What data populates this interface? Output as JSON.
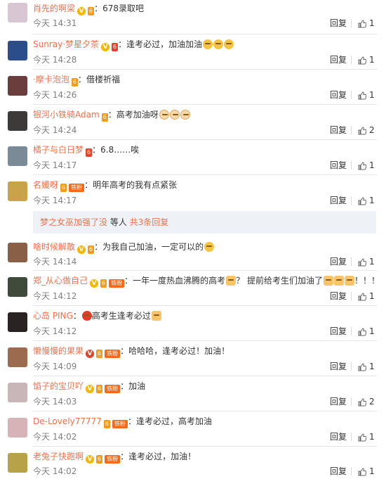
{
  "ui": {
    "reply_label": "回复"
  },
  "comments": [
    {
      "username": "肖先的啊梁",
      "text": "678录取吧",
      "time": "今天 14:31",
      "likes": "1",
      "avatar_color": "#d8c6d3"
    },
    {
      "username": "Sunray·梦星夕茶",
      "text": "逢考必过，加油加油",
      "time": "今天 14:28",
      "likes": "1",
      "avatar_color": "#2b4d8a"
    },
    {
      "username": "·摩卡泡泡",
      "text": "借楼祈福",
      "time": "今天 14:26",
      "likes": "1",
      "avatar_color": "#6b3d3d"
    },
    {
      "username": "银河小铁骑Adam",
      "text": "高考加油呀",
      "time": "今天 14:24",
      "likes": "2",
      "avatar_color": "#3d3a3a"
    },
    {
      "username": "橘子与白日梦",
      "text": "6.8……唉",
      "time": "今天 14:17",
      "likes": "1",
      "avatar_color": "#7a8a96"
    },
    {
      "username": "名媛呀",
      "text": "明年高考的我有点紧张",
      "time": "今天 14:17",
      "likes": "1",
      "avatar_color": "#c9a24a"
    },
    {
      "username": "啥时候解散",
      "text": "为我自己加油，一定可以的",
      "time": "今天 14:14",
      "likes": "1",
      "avatar_color": "#8a5f48"
    },
    {
      "username": "郑_从心做自己",
      "text": "一年一度热血沸腾的高考",
      "text2": "？ 提前给考生们加油了",
      "text3": "！！！",
      "time": "今天 14:12",
      "likes": "1",
      "avatar_color": "#3f4a3a"
    },
    {
      "username": "心岛 PING",
      "text": "高考生逢考必过",
      "time": "今天 14:12",
      "likes": "1",
      "avatar_color": "#2a2323"
    },
    {
      "username": "懒慢慢的果果",
      "text": "哈哈哈，逢考必过！加油！",
      "time": "今天 14:09",
      "likes": "1",
      "avatar_color": "#9b6a4f"
    },
    {
      "username": "馅子的宝贝吖",
      "text": "加油",
      "time": "今天 14:03",
      "likes": "2",
      "avatar_color": "#c9b6b8"
    },
    {
      "username": "De-Lovely77777",
      "text": "逢考必过，高考加油",
      "time": "今天 14:02",
      "likes": "1",
      "avatar_color": "#d6b3b6"
    },
    {
      "username": "老兔子快跑啊",
      "text": "逢考必过，加油！",
      "time": "今天 14:02",
      "likes": "1",
      "avatar_color": "#b7a24a"
    }
  ],
  "more_replies": {
    "name": "梦之女巫加强了没",
    "middle": " 等人 ",
    "link": "共3条回复"
  },
  "badges": {
    "v": "V",
    "fan": "铁粉",
    "level": "6"
  }
}
